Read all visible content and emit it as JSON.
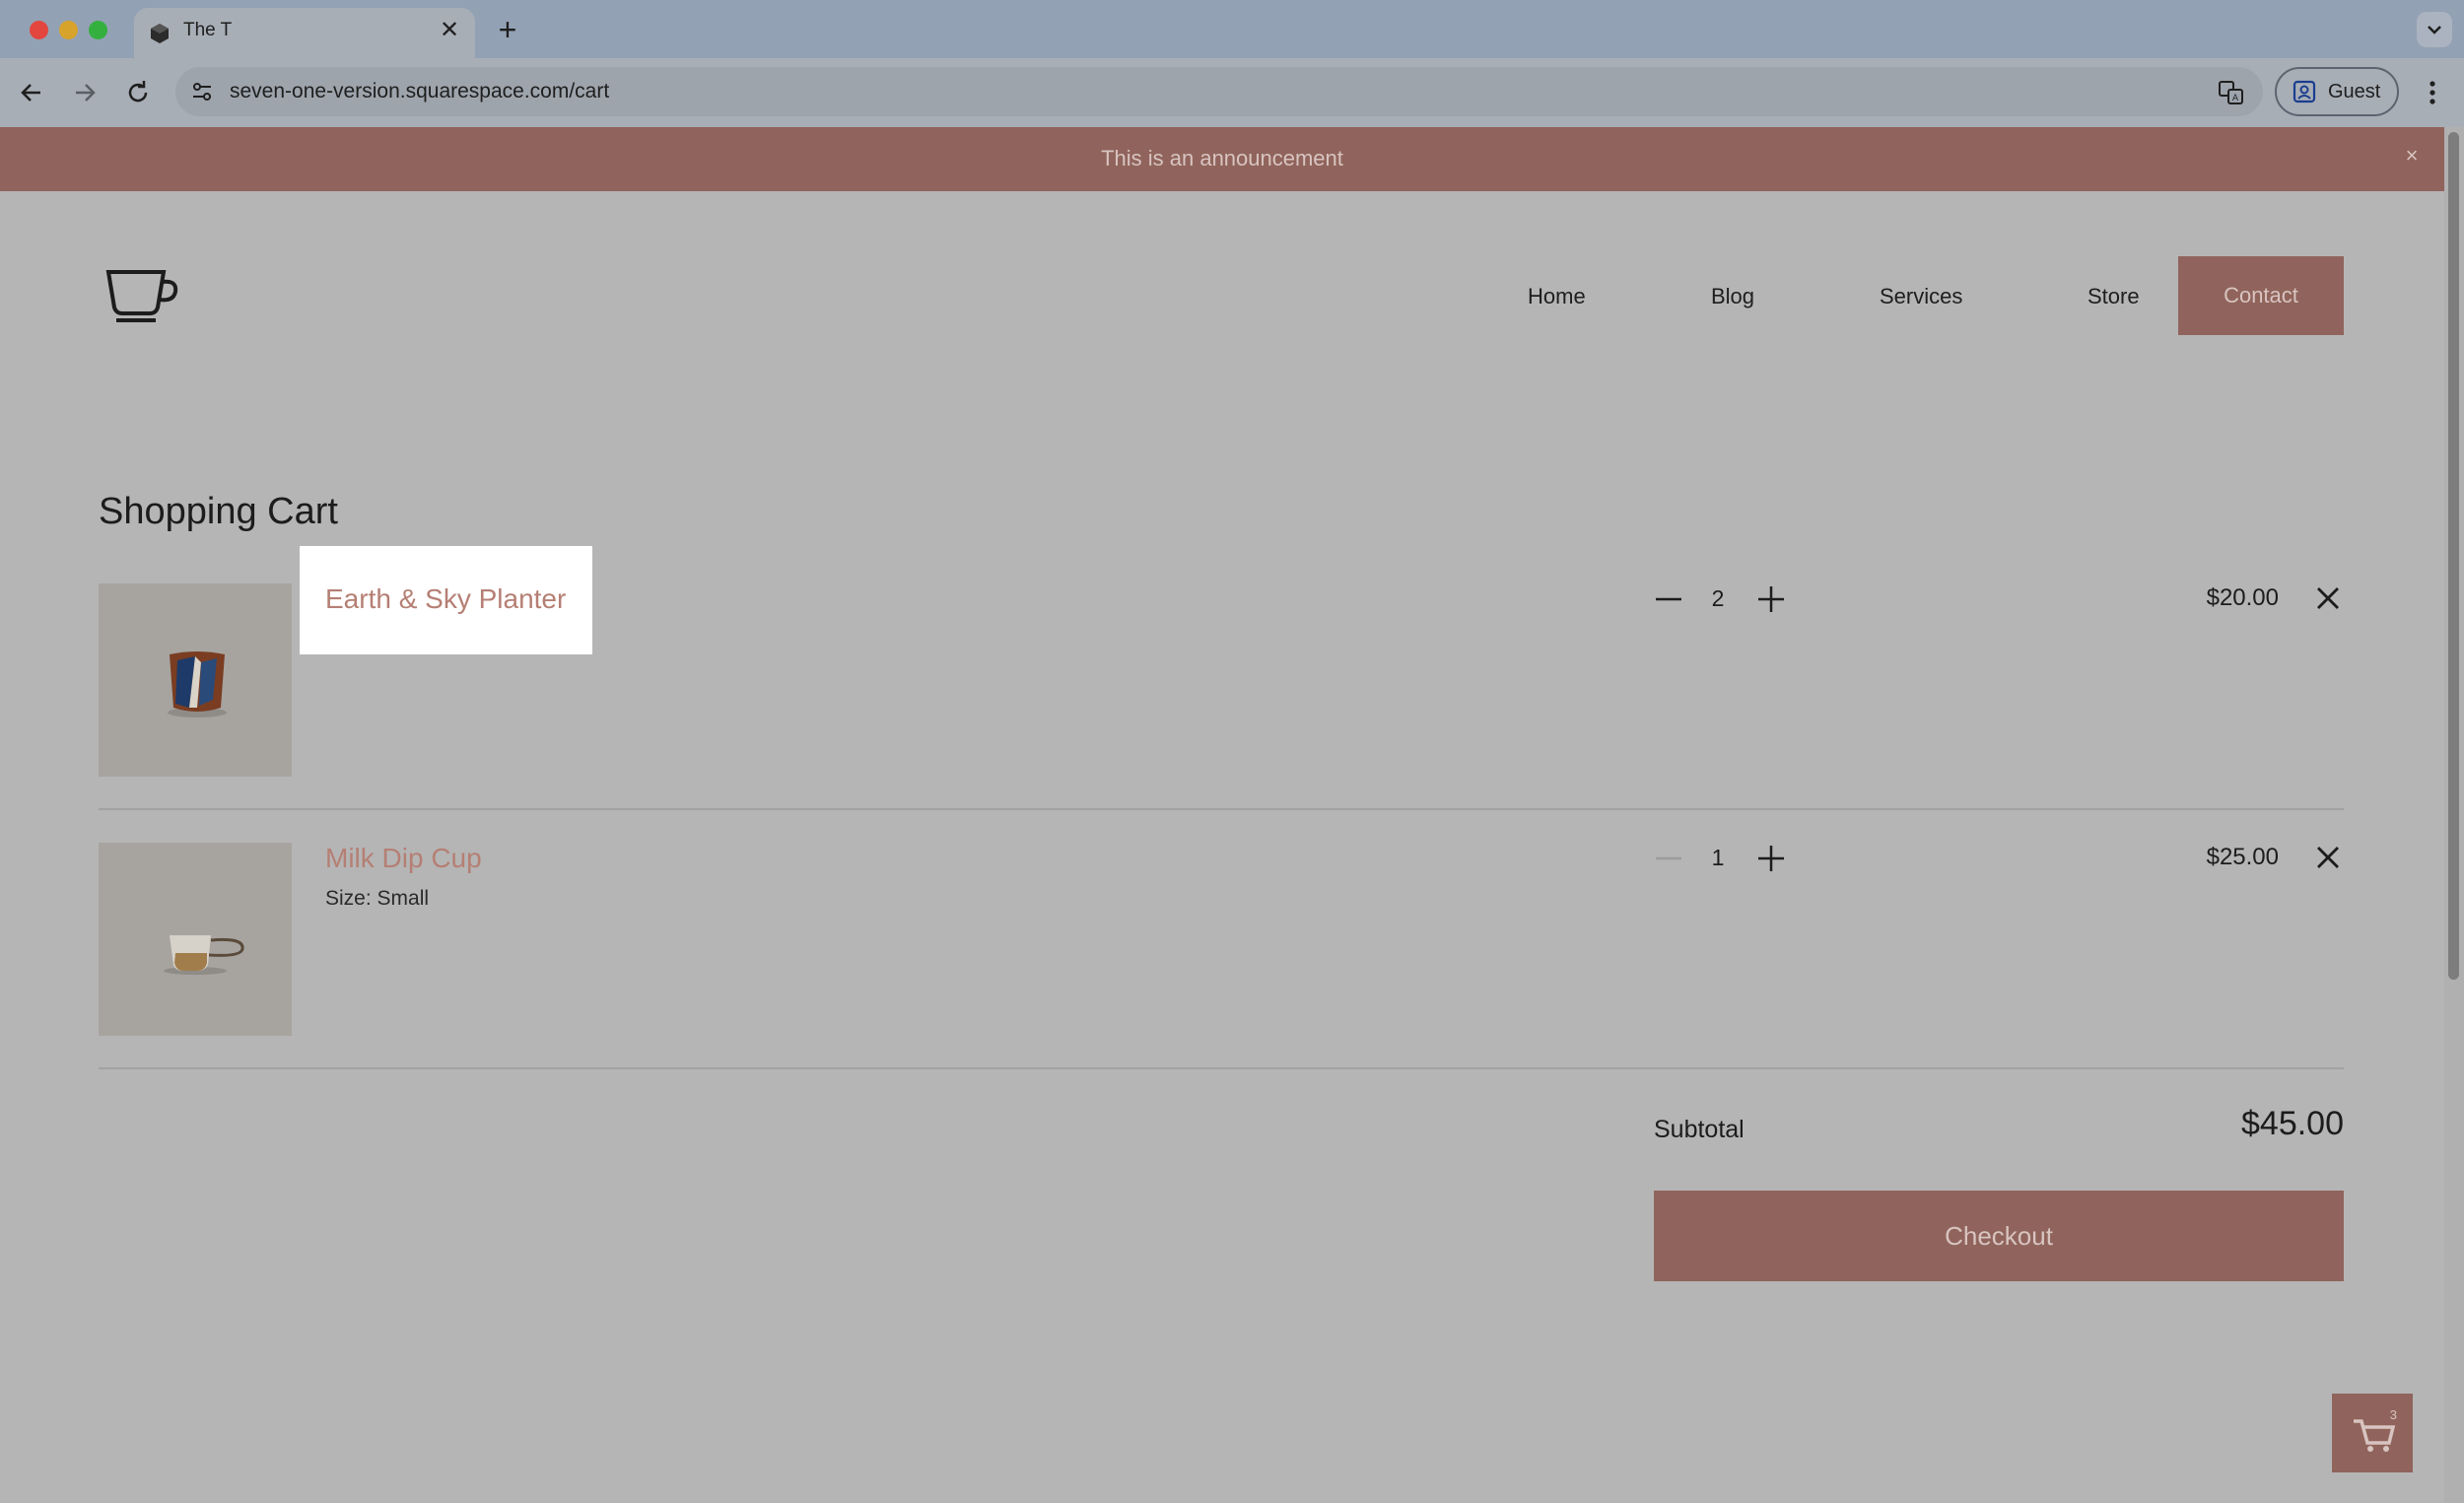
{
  "browser": {
    "tab_title": "The T",
    "tab_close": "✕",
    "new_tab": "+",
    "url": "seven-one-version.squarespace.com/cart",
    "profile_label": "Guest"
  },
  "announcement": {
    "text": "This is an announcement",
    "close": "×"
  },
  "nav": {
    "items": [
      "Home",
      "Blog",
      "Services",
      "Store"
    ],
    "cta": "Contact"
  },
  "cart": {
    "title": "Shopping Cart",
    "items": [
      {
        "name": "Earth & Sky Planter",
        "option": "",
        "quantity": "2",
        "price": "$20.00"
      },
      {
        "name": "Milk Dip Cup",
        "option": "Size: Small",
        "quantity": "1",
        "price": "$25.00"
      }
    ],
    "subtotal_label": "Subtotal",
    "subtotal_value": "$45.00",
    "checkout_label": "Checkout",
    "cart_badge_count": "3"
  },
  "colors": {
    "accent": "#90645c",
    "link": "#b57f74",
    "overlay_bg": "#b5b5b5"
  }
}
